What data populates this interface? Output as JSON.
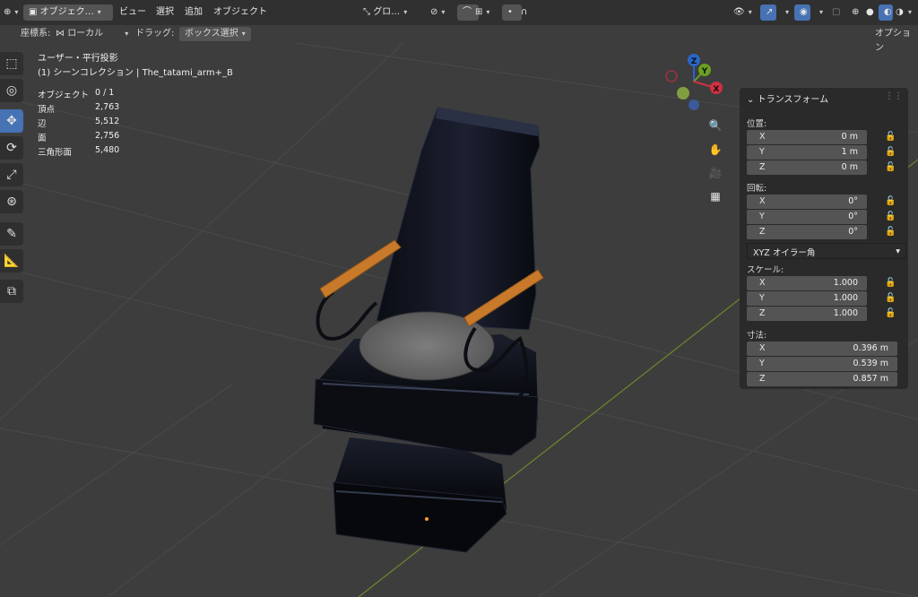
{
  "header": {
    "mode_label": "オブジェク…",
    "menus": [
      "ビュー",
      "選択",
      "追加",
      "オブジェクト"
    ],
    "transform_orientation": "グロ…",
    "options_button": "オプション"
  },
  "options_row": {
    "orientation_label": "座標系:",
    "orientation_value": "ローカル",
    "drag_label": "ドラッグ:",
    "drag_value": "ボックス選択"
  },
  "viewport": {
    "view_name": "ユーザー・平行投影",
    "collection": "(1) シーンコレクション | The_tatami_arm+_B",
    "stats": [
      {
        "label": "オブジェクト",
        "value": "0 / 1"
      },
      {
        "label": "頂点",
        "value": "2,763"
      },
      {
        "label": "辺",
        "value": "5,512"
      },
      {
        "label": "面",
        "value": "2,756"
      },
      {
        "label": "三角形面",
        "value": "5,480"
      }
    ],
    "gizmo": {
      "z": "Z",
      "y": "Y",
      "x": "X"
    }
  },
  "npanel": {
    "title": "トランスフォーム",
    "location": {
      "label": "位置:",
      "x": "0 m",
      "y": "1 m",
      "z": "0 m"
    },
    "rotation": {
      "label": "回転:",
      "x": "0°",
      "y": "0°",
      "z": "0°"
    },
    "rotation_mode": "XYZ オイラー角",
    "scale": {
      "label": "スケール:",
      "x": "1.000",
      "y": "1.000",
      "z": "1.000"
    },
    "dimensions": {
      "label": "寸法:",
      "x": "0.396 m",
      "y": "0.539 m",
      "z": "0.857 m"
    },
    "axis": {
      "x": "X",
      "y": "Y",
      "z": "Z"
    }
  },
  "colors": {
    "accent": "#4772b3",
    "background": "#3d3d3d",
    "panel": "#2a2a2a",
    "wood": "#c87a2a"
  }
}
